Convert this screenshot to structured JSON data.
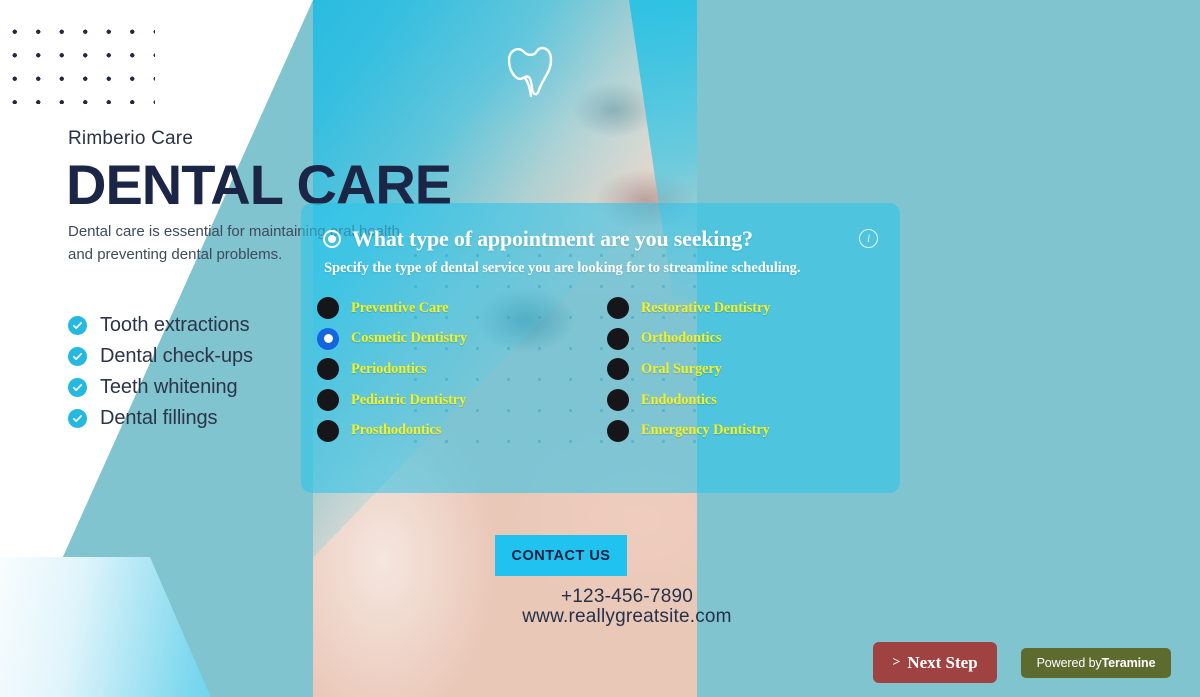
{
  "brand": {
    "name": "Rimberio Care"
  },
  "hero": {
    "headline": "DENTAL CARE",
    "subcopy": "Dental care is essential for maintaining oral health and preventing dental problems.",
    "tooth_icon": "tooth-icon"
  },
  "services_list": [
    {
      "label": "Tooth extractions",
      "icon": "check-circle-icon"
    },
    {
      "label": "Dental check-ups",
      "icon": "check-circle-icon"
    },
    {
      "label": "Teeth whitening",
      "icon": "check-circle-icon"
    },
    {
      "label": "Dental fillings",
      "icon": "check-circle-icon"
    }
  ],
  "contact": {
    "button_label": "CONTACT US",
    "phone": "+123-456-7890",
    "website": "www.reallygreatsite.com"
  },
  "panel": {
    "title": "What type of appointment are you seeking?",
    "subtitle": "Specify the type of dental service you are looking for to streamline scheduling.",
    "info_icon": "info-icon",
    "info_glyph": "i",
    "left_options": [
      {
        "label": "Preventive Care",
        "selected": false
      },
      {
        "label": "Cosmetic Dentistry",
        "selected": true
      },
      {
        "label": "Periodontics",
        "selected": false
      },
      {
        "label": "Pediatric Dentistry",
        "selected": false
      },
      {
        "label": "Prosthodontics",
        "selected": false
      }
    ],
    "right_options": [
      {
        "label": "Restorative Dentistry",
        "selected": false
      },
      {
        "label": "Orthodontics",
        "selected": false
      },
      {
        "label": "Oral Surgery",
        "selected": false
      },
      {
        "label": "Endodontics",
        "selected": false
      },
      {
        "label": "Emergency Dentistry",
        "selected": false
      }
    ]
  },
  "footer": {
    "next_chevron": ">",
    "next_label": "Next Step",
    "powered_prefix": "Powered by",
    "powered_brand": "Teramine"
  },
  "colors": {
    "page_background": "#7fc4ce",
    "accent_cyan": "#20c3ef",
    "panel_overlay": "#2ec2e8",
    "option_label_yellow": "#f2f224",
    "selected_radio_blue": "#1564e0",
    "unselected_radio": "#16161a",
    "headline_navy": "#1b2545",
    "next_step_red": "#a04242",
    "powered_olive": "#5d6b2f"
  }
}
